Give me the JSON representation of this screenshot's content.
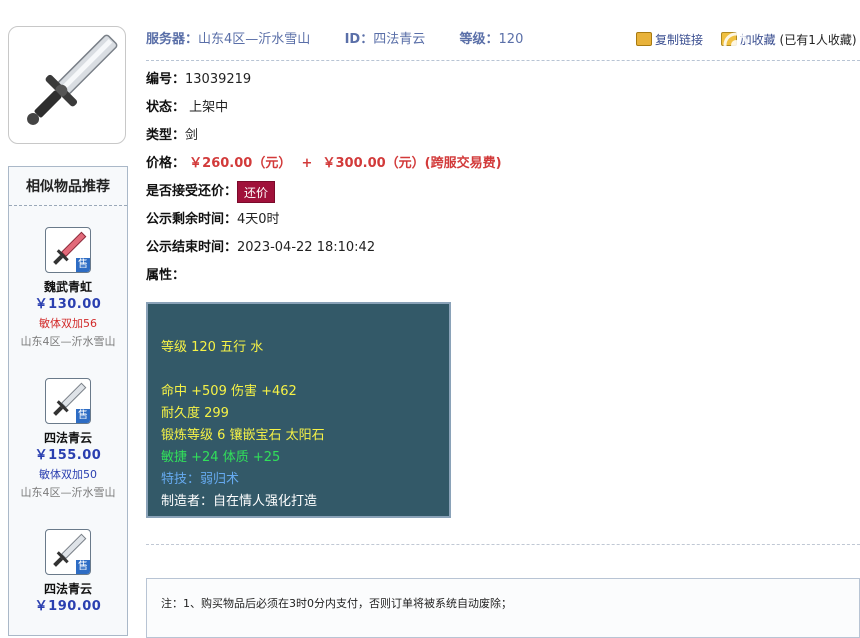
{
  "header": {
    "server_label": "服务器：",
    "server_value": "山东4区—沂水雪山",
    "id_label": "ID：",
    "id_value": "四法青云",
    "level_label": "等级：",
    "level_value": "120",
    "copy_link": "复制链接",
    "favorite": "加收藏",
    "favorited": "(已有1人收藏)"
  },
  "item": {
    "serial_label": "编号：",
    "serial_value": "13039219",
    "status_label": "状态：",
    "status_value": "上架中",
    "type_label": "类型：",
    "type_value": "剑",
    "price_label": "价格：",
    "price_value": "￥260.00（元）",
    "price_plus": "+",
    "fee_value": "￥300.00（元）(跨服交易费)",
    "bargain_label": "是否接受还价：",
    "bargain_button": "还价",
    "remaining_label": "公示剩余时间：",
    "remaining_value": "4天0时",
    "end_label": "公示结束时间：",
    "end_value": "2023-04-22 18:10:42",
    "attr_label": "属性："
  },
  "attributes": {
    "line1": "等级 120 五行 水",
    "line2": "命中 +509 伤害 +462",
    "line3": "耐久度 299",
    "line4": "锻炼等级 6 镶嵌宝石 太阳石",
    "line5": "敏捷 +24 体质 +25",
    "line6": "特技：弱归术",
    "line7": "制造者：自在情人强化打造"
  },
  "similar": {
    "title": "相似物品推荐",
    "badge": "售",
    "items": [
      {
        "name": "魏武青虹",
        "price": "￥130.00",
        "attr": "敏体双加56",
        "server": "山东4区—沂水雪山",
        "attr_color": "#d22a2a"
      },
      {
        "name": "四法青云",
        "price": "￥155.00",
        "attr": "敏体双加50",
        "server": "山东4区—沂水雪山",
        "attr_color": "#2a3fb0"
      },
      {
        "name": "四法青云",
        "price": "￥190.00"
      }
    ]
  },
  "notice": {
    "line1": "注：1、购买物品后必须在3时0分内支付，否则订单将被系统自动废除；"
  },
  "colors": {
    "accent": "#2a3fb0",
    "price_red": "#d23a3a",
    "bargain_button": "#a0113a",
    "attr_panel_bg": "#335968"
  }
}
